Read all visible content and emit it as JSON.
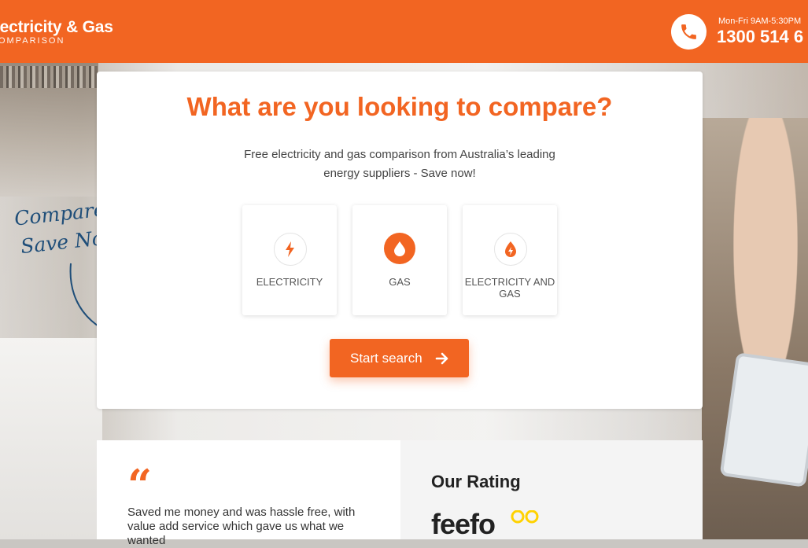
{
  "header": {
    "logo_main": "lectricity & Gas",
    "logo_sub": "OMPARISON",
    "hours": "Mon-Fri 9AM-5:30PM",
    "phone": "1300 514 6"
  },
  "hero": {
    "title": "What are you looking to compare?",
    "subtitle": "Free electricity and gas comparison from Australia’s leading energy suppliers - Save now!",
    "options": [
      {
        "label": "ELECTRICITY",
        "icon": "lightning-icon"
      },
      {
        "label": "GAS",
        "icon": "flame-drop-icon"
      },
      {
        "label": "ELECTRICITY AND GAS",
        "icon": "flame-bolt-icon"
      }
    ],
    "cta_label": "Start search",
    "handwritten_line1": "Compare &",
    "handwritten_line2": "Save Now!"
  },
  "testimonial": {
    "quote_mark": "“",
    "text": "Saved me money and was hassle free, with value add service which gave us what we wanted"
  },
  "rating": {
    "title": "Our Rating",
    "brand": "feefo"
  },
  "colors": {
    "brand_orange": "#f26522",
    "hand_blue": "#1f4e79"
  }
}
